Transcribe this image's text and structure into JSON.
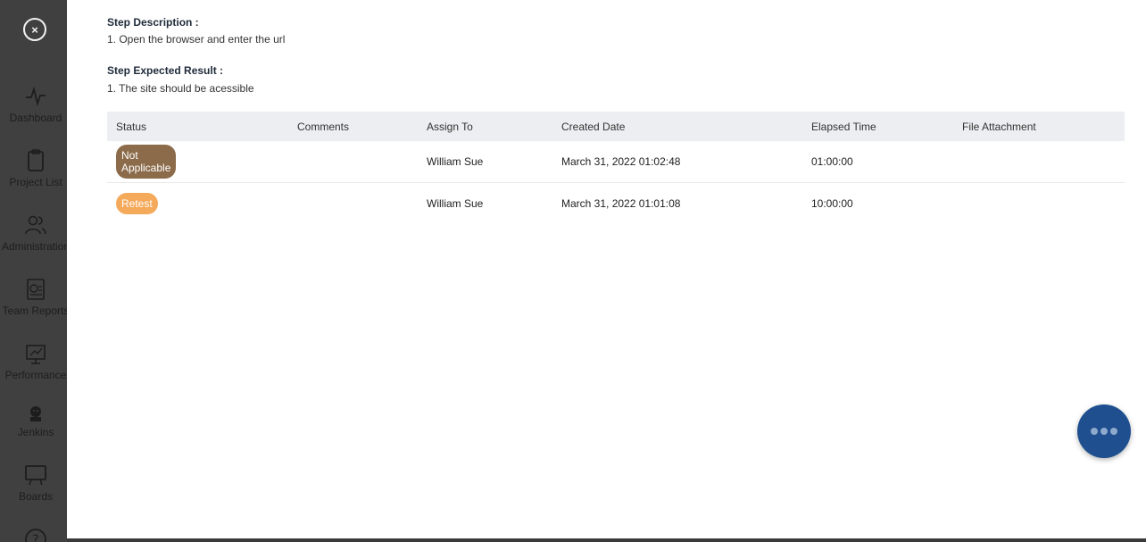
{
  "sidebar": {
    "close_label": "×",
    "items": [
      {
        "label": "Dashboard",
        "icon": "pulse-icon"
      },
      {
        "label": "Project List",
        "icon": "clipboard-icon"
      },
      {
        "label": "Administration",
        "icon": "users-icon"
      },
      {
        "label": "Team Reports",
        "icon": "report-icon"
      },
      {
        "label": "Performance",
        "icon": "performance-icon"
      },
      {
        "label": "Jenkins",
        "icon": "jenkins-icon"
      },
      {
        "label": "Boards",
        "icon": "board-icon"
      }
    ]
  },
  "step": {
    "description_title": "Step Description :",
    "description_text": "1. Open the browser and enter the url",
    "expected_title": "Step Expected Result :",
    "expected_text": "1. The site should be acessible"
  },
  "table": {
    "headers": [
      "Status",
      "Comments",
      "Assign To",
      "Created Date",
      "Elapsed Time",
      "File Attachment"
    ],
    "rows": [
      {
        "status": "Not Applicable",
        "status_color": "#8b6b4a",
        "comments": "",
        "assign_to": "William Sue",
        "created": "March 31, 2022 01:02:48",
        "elapsed": "01:00:00",
        "file": ""
      },
      {
        "status": "Retest",
        "status_color": "#f5a95a",
        "comments": "",
        "assign_to": "William Sue",
        "created": "March 31, 2022 01:01:08",
        "elapsed": "10:00:00",
        "file": ""
      }
    ]
  },
  "fab": {
    "icon": "more-dots-icon",
    "color": "#1f4f8f"
  }
}
